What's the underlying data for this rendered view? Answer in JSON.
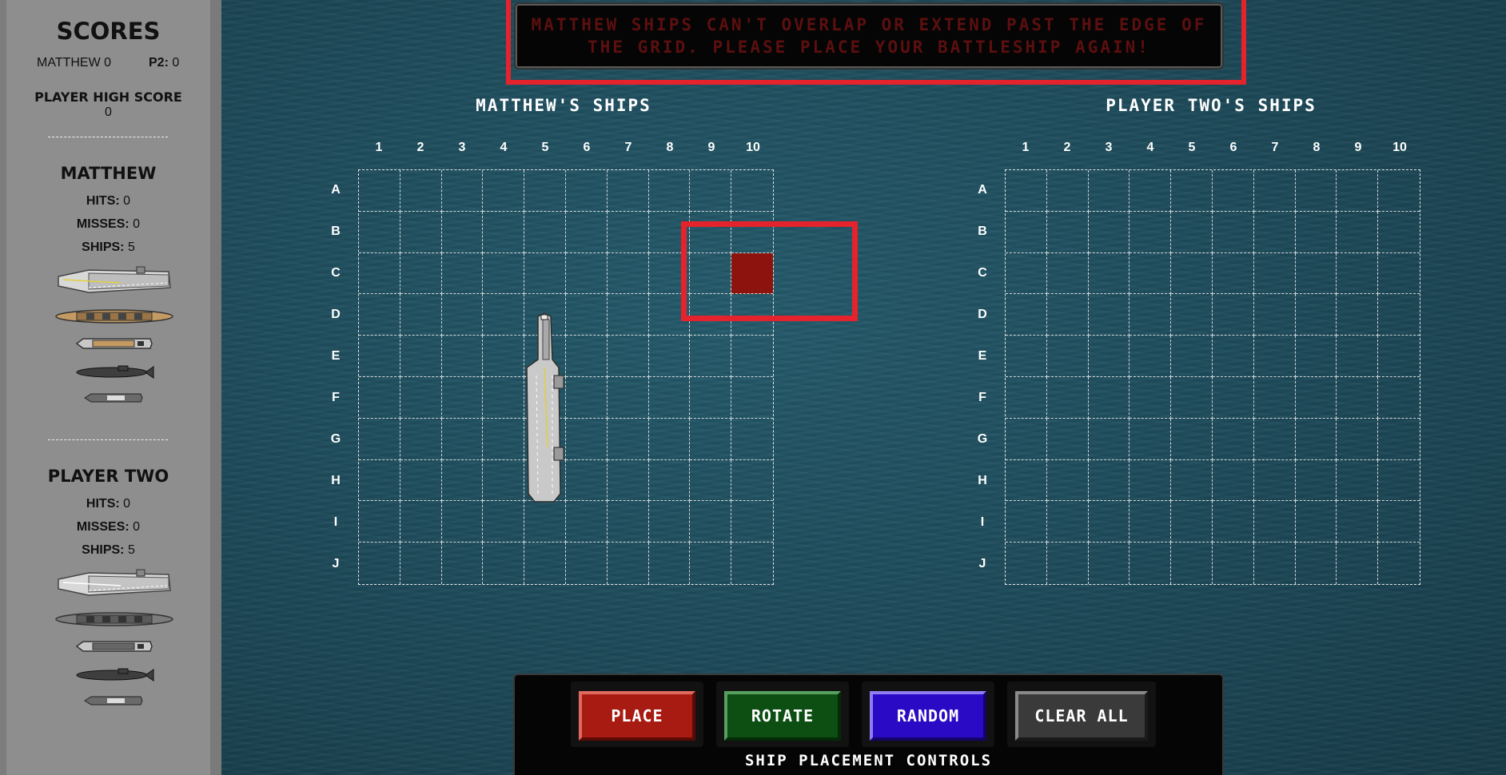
{
  "sidebar": {
    "title": "SCORES",
    "score_matthew_label": "MATTHEW",
    "score_matthew_value": "0",
    "score_p2_label": "P2:",
    "score_p2_value": "0",
    "high_score_label": "PLAYER HIGH SCORE",
    "high_score_value": "0",
    "player1": {
      "name": "MATTHEW",
      "hits_label": "HITS:",
      "hits": "0",
      "misses_label": "MISSES:",
      "misses": "0",
      "ships_label": "SHIPS:",
      "ships": "5"
    },
    "player2": {
      "name": "PLAYER TWO",
      "hits_label": "HITS:",
      "hits": "0",
      "misses_label": "MISSES:",
      "misses": "0",
      "ships_label": "SHIPS:",
      "ships": "5"
    }
  },
  "message": "MATTHEW SHIPS CAN'T OVERLAP OR EXTEND PAST THE EDGE OF THE GRID. PLEASE PLACE YOUR BATTLESHIP AGAIN!",
  "boards": {
    "left_title": "MATTHEW'S SHIPS",
    "right_title": "PLAYER TWO'S SHIPS",
    "columns": [
      "1",
      "2",
      "3",
      "4",
      "5",
      "6",
      "7",
      "8",
      "9",
      "10"
    ],
    "rows": [
      "A",
      "B",
      "C",
      "D",
      "E",
      "F",
      "G",
      "H",
      "I",
      "J"
    ],
    "highlighted_cell": "C10"
  },
  "controls": {
    "place": "PLACE",
    "rotate": "ROTATE",
    "random": "RANDOM",
    "clear_all": "CLEAR ALL",
    "label": "SHIP PLACEMENT CONTROLS"
  },
  "colors": {
    "alert_red": "#e5232d",
    "hit_cell": "#8d140e",
    "place_btn": "#a81b13",
    "rotate_btn": "#0d4e12",
    "random_btn": "#2b0ac6",
    "clear_btn": "#3a3a3a"
  }
}
